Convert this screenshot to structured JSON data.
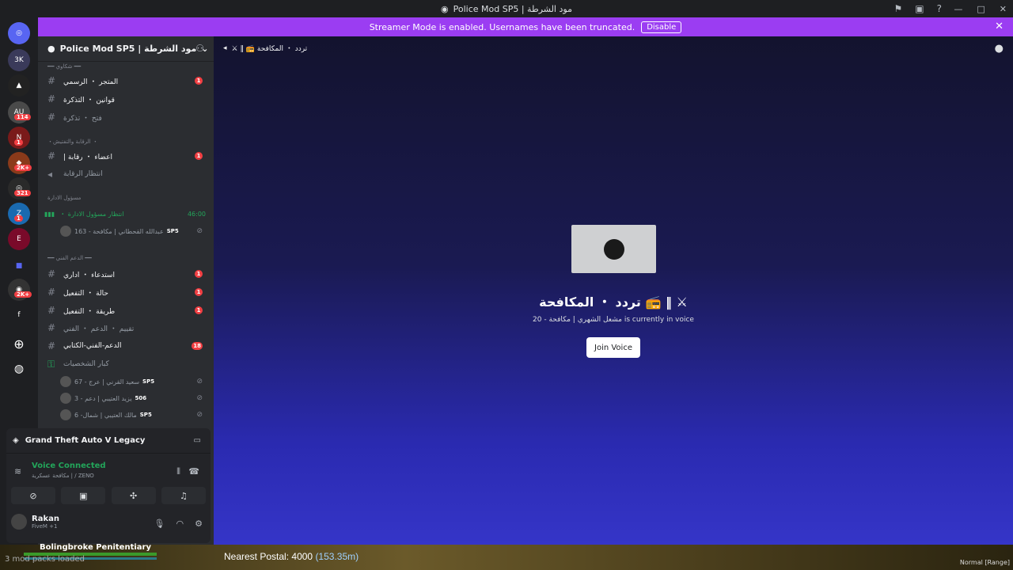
{
  "window": {
    "title": "Police Mod SP5 | مود الشرطة",
    "controls": [
      "—",
      "□",
      "✕"
    ]
  },
  "banner": {
    "text": "Streamer Mode is enabled. Usernames have been truncated.",
    "button": "Disable"
  },
  "rail": {
    "badges": [
      "114",
      "1",
      "2K+",
      "321",
      "1",
      "2K+"
    ]
  },
  "server": {
    "name": "Police Mod SP5 | مود الشرطة"
  },
  "channels": {
    "cat1": "━━ شكاوي ━━",
    "c1": "المتجر ・ الرسمي",
    "c1_unread": "1",
    "c2": "قوانين ・ التذكرة",
    "c3": "فتح ・ تذكرة",
    "cat2": "・الرقابة والتفتيش ・",
    "c4": "اعضاء ・ رقابة |",
    "c4_unread": "1",
    "c5": "انتظار الرقابة",
    "cat3": "مسؤول الادارة",
    "voice1": "انتظار مسؤول الادارة ・",
    "voice1_time": "46:00",
    "voice1_user": "عبدالله القحطاني | مكافحة - 163",
    "voice1_tag": "SP5",
    "cat4": "━━ الدعم الفني ━━",
    "c6": "استدعاء ・ اداري",
    "c6_unread": "1",
    "c7": "حالة ・ التفعيل",
    "c7_unread": "1",
    "c8": "طريقة ・ التفعيل",
    "c8_unread": "1",
    "c9": "تقييم ・ الدعم ・ الفني",
    "c10": "الدعم-الفني-الكتابي",
    "c10_unread": "18",
    "voice2": "كبار الشخصيات",
    "u1": "سعيد القرني | عرج - 67",
    "u1_tag": "SP5",
    "u2": "يزيد العتيبي | دعم - 3",
    "u2_tag": "506",
    "u3": "مالك العتيبي | شمال- 6",
    "u3_tag": "SP5"
  },
  "panel": {
    "game": "Grand Theft Auto V Legacy",
    "voice_status": "Voice Connected",
    "voice_sub": "مكافحة عسكرية | / ZENO",
    "username": "Rakan",
    "user_sub": "FiveM +1"
  },
  "main": {
    "channel_header": "تردد ・ المكافحة 📻 ‖ ⚔",
    "voice_title": "تردد ・ المكافحة 📻 ‖ ⚔",
    "voice_status": "مشعل الشهري | مكافحة - 20 is currently in voice",
    "join_button": "Join Voice"
  },
  "game_hud": {
    "location": "Bolingbroke Penitentiary",
    "packs": "3 mod packs loaded",
    "postal_label": "Nearest Postal:",
    "postal_value": "4000",
    "postal_distance": "(153.35m)",
    "range": "Normal [Range]"
  },
  "colors": {
    "accent": "#9b3df2",
    "online": "#23a55a",
    "unread": "#f23f43"
  }
}
